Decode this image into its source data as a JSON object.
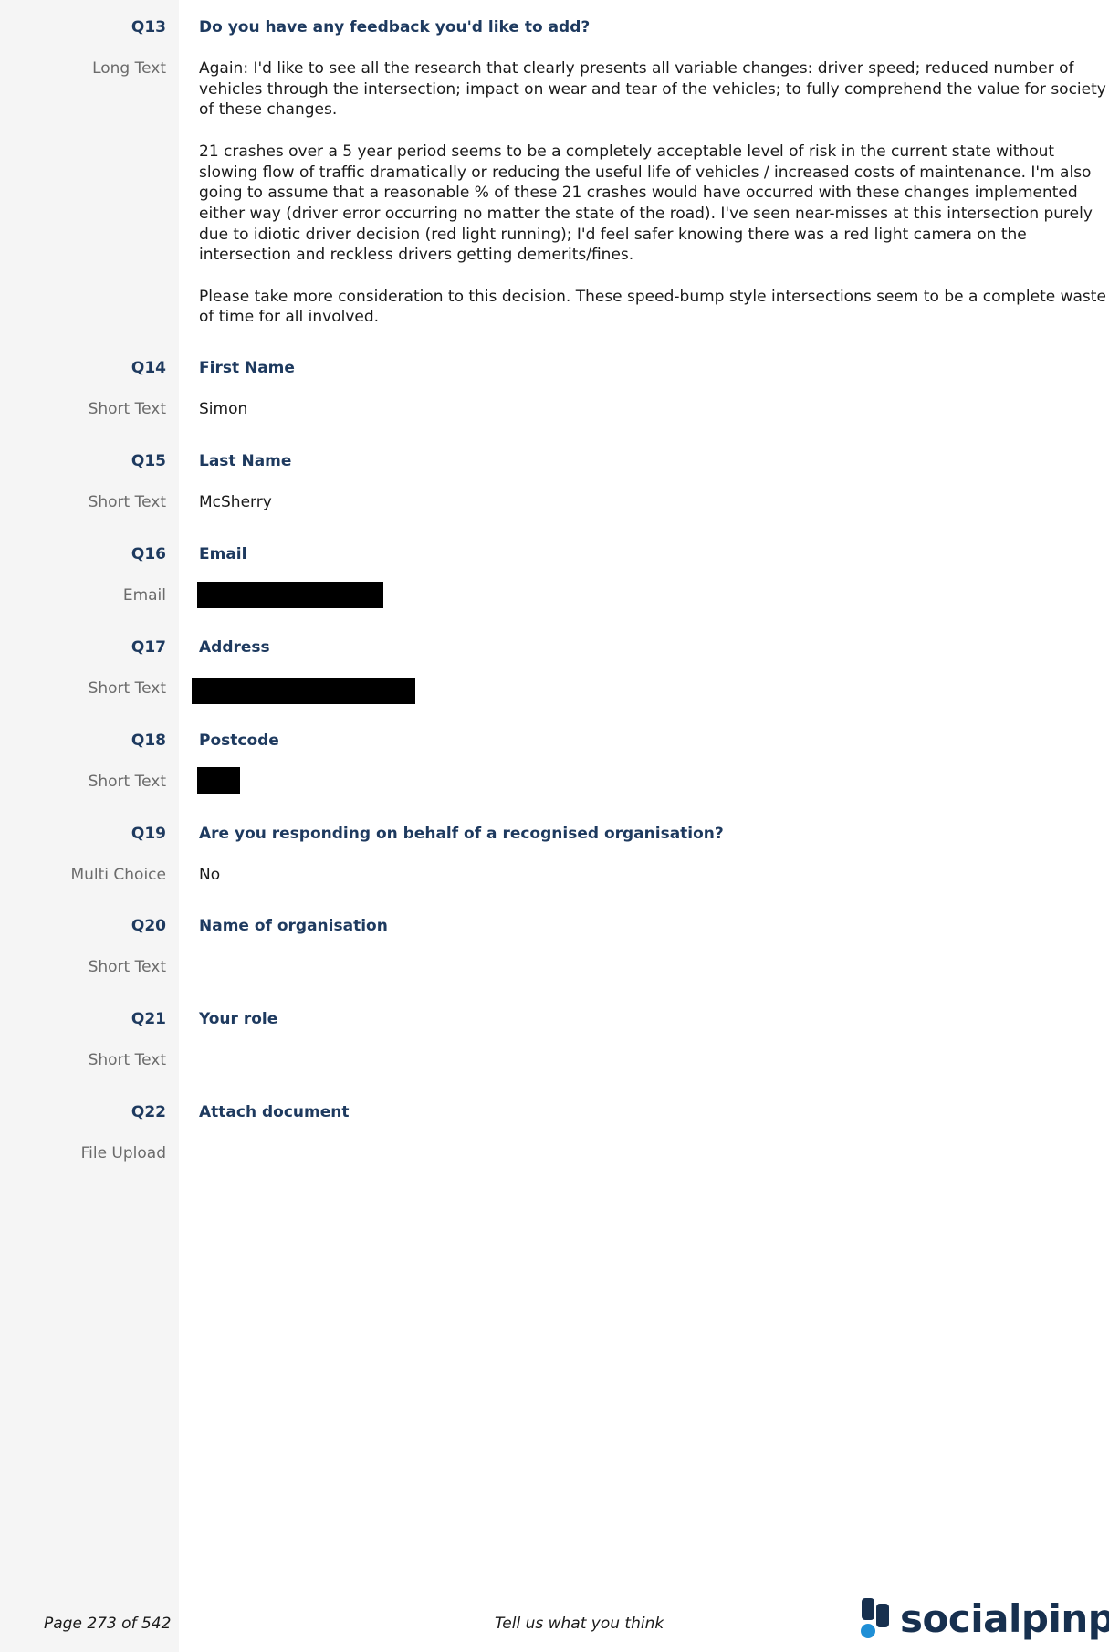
{
  "questions": [
    {
      "num": "Q13",
      "title": "Do you have any feedback you'd like to add?",
      "type": "Long Text",
      "paragraphs": [
        "Again: I'd like to see all the research that clearly presents all variable changes: driver speed; reduced number of vehicles through the intersection; impact on wear and tear of the vehicles; to fully comprehend the value for society of these changes.",
        "21 crashes over a 5 year period seems to be a completely acceptable level of risk in the current state without slowing flow of traffic dramatically or reducing the useful life of vehicles / increased costs of maintenance. I'm also going to assume that a reasonable % of these 21 crashes would have occurred with these changes implemented either way (driver error occurring no matter the state of the road). I've seen near-misses at this intersection purely due to idiotic driver decision (red light running); I'd feel safer knowing there was a red light camera on the intersection and reckless drivers getting demerits/fines.",
        "Please take more consideration to this decision. These speed-bump style intersections seem to be a complete waste of time for all involved."
      ]
    },
    {
      "num": "Q14",
      "title": "First Name",
      "type": "Short Text",
      "answer": "Simon"
    },
    {
      "num": "Q15",
      "title": "Last Name",
      "type": "Short Text",
      "answer": "McSherry"
    },
    {
      "num": "Q16",
      "title": "Email",
      "type": "Email",
      "answer": ""
    },
    {
      "num": "Q17",
      "title": "Address",
      "type": "Short Text",
      "answer": ""
    },
    {
      "num": "Q18",
      "title": "Postcode",
      "type": "Short Text",
      "answer": ""
    },
    {
      "num": "Q19",
      "title": "Are you responding on behalf of a recognised organisation?",
      "type": "Multi Choice",
      "answer": "No"
    },
    {
      "num": "Q20",
      "title": "Name of organisation",
      "type": "Short Text",
      "answer": ""
    },
    {
      "num": "Q21",
      "title": "Your role",
      "type": "Short Text",
      "answer": ""
    },
    {
      "num": "Q22",
      "title": "Attach document",
      "type": "File Upload",
      "answer": ""
    }
  ],
  "footer": {
    "page": "Page 273 of 542",
    "tagline": "Tell us what you think",
    "logo_text": "socialpinpoint"
  },
  "colors": {
    "sidebar_bg": "#f5f5f5",
    "question_title": "#1e3a5f",
    "type_label": "#6b6b6b",
    "logo_navy": "#17304f",
    "logo_blue": "#1f8fd6"
  }
}
